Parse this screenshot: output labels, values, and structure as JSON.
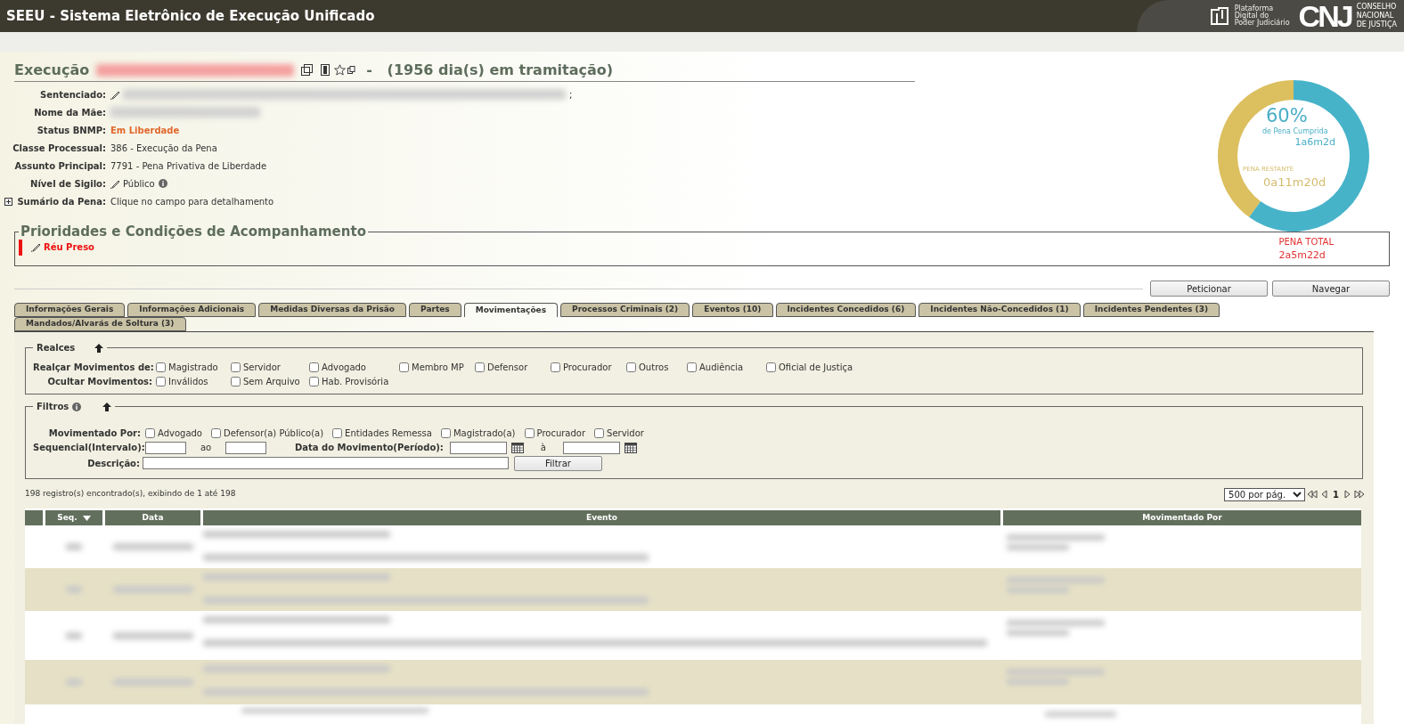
{
  "header": {
    "title": "SEEU - Sistema Eletrônico de Execução Unificado",
    "platform_lines": [
      "Plataforma",
      "Digital do",
      "Poder Judiciário"
    ],
    "cnj_logo": "CNJ",
    "council_lines": [
      "CONSELHO",
      "NACIONAL",
      "DE JUSTIÇA"
    ]
  },
  "process": {
    "title": "Execução",
    "days": "-   (1956 dia(s) em tramitação)"
  },
  "fields": [
    {
      "label": "Sentenciado:",
      "kind": "redacted",
      "pencil": true,
      "suffix": ";"
    },
    {
      "label": "Nome da Mãe:",
      "kind": "redacted",
      "pencil": false
    },
    {
      "label": "Status BNMP:",
      "kind": "status",
      "value": "Em Liberdade",
      "pencil": false
    },
    {
      "label": "Classe Processual:",
      "kind": "text",
      "value": "386 - Execução da Pena",
      "pencil": false
    },
    {
      "label": "Assunto Principal:",
      "kind": "text",
      "value": "7791 - Pena Privativa de Liberdade",
      "pencil": false
    },
    {
      "label": "Nível de Sigilo:",
      "kind": "text",
      "value": "Público",
      "pencil": true,
      "info": true
    },
    {
      "label": "Sumário da Pena:",
      "kind": "text",
      "value": "Clique no campo para detalhamento",
      "pencil": false,
      "expander": true
    }
  ],
  "sentence": {
    "chart_data": {
      "type": "donut",
      "categories": [
        "de Pena Cumprida",
        "PENA RESTANTE"
      ],
      "values": [
        60,
        40
      ]
    },
    "percent": "60%",
    "served": "1a6m2d",
    "remaining": "0a11m20d",
    "total_label": "PENA TOTAL",
    "total": "2a5m22d"
  },
  "priorities": {
    "legend": "Prioridades e Condições de Acompanhamento",
    "items": [
      {
        "label": "Réu Preso",
        "color": "#ee1111"
      }
    ]
  },
  "buttons": [
    "Peticionar",
    "Navegar"
  ],
  "tabs": [
    {
      "label": "Informações Gerais",
      "selected": false
    },
    {
      "label": "Informações Adicionais",
      "selected": false
    },
    {
      "label": "Medidas Diversas da Prisão",
      "selected": false
    },
    {
      "label": "Partes",
      "selected": false
    },
    {
      "label": "Movimentações",
      "selected": true
    },
    {
      "label": "Processos Criminais (2)",
      "selected": false
    },
    {
      "label": "Eventos (10)",
      "selected": false
    },
    {
      "label": "Incidentes Concedidos (6)",
      "selected": false
    },
    {
      "label": "Incidentes Não-Concedidos (1)",
      "selected": false
    },
    {
      "label": "Incidentes Pendentes (3)",
      "selected": false
    },
    {
      "label": "Mandados/Alvarás de Soltura (3)",
      "selected": false
    }
  ],
  "realces": {
    "legend": "Realces",
    "rows": [
      {
        "label": "Realçar Movimentos de:",
        "options": [
          {
            "label": "Magistrado",
            "checked": false
          },
          {
            "label": "Servidor",
            "checked": false
          },
          {
            "label": "Advogado",
            "checked": false
          },
          {
            "label": "Membro MP",
            "checked": false
          },
          {
            "label": "Defensor",
            "checked": false
          },
          {
            "label": "Procurador",
            "checked": false
          },
          {
            "label": "Outros",
            "checked": false
          },
          {
            "label": "Audiência",
            "checked": false
          },
          {
            "label": "Oficial de Justiça",
            "checked": false
          }
        ]
      },
      {
        "label": "Ocultar Movimentos:",
        "options": [
          {
            "label": "Inválidos",
            "checked": false
          },
          {
            "label": "Sem Arquivo",
            "checked": false
          },
          {
            "label": "Hab. Provisória",
            "checked": false
          }
        ]
      }
    ]
  },
  "filtros": {
    "legend": "Filtros",
    "check_label": "Movimentado Por:",
    "options": [
      {
        "label": "Advogado",
        "checked": false
      },
      {
        "label": "Defensor(a) Público(a)",
        "checked": false
      },
      {
        "label": "Entidades Remessa",
        "checked": false
      },
      {
        "label": "Magistrado(a)",
        "checked": false
      },
      {
        "label": "Procurador",
        "checked": false
      },
      {
        "label": "Servidor",
        "checked": false
      }
    ],
    "seq_label": "Sequencial(Intervalo):",
    "seq_between": "ao",
    "date_label": "Data do Movimento(Período):",
    "date_between": "à",
    "desc_label": "Descrição:",
    "button": "Filtrar"
  },
  "results": {
    "summary": "198 registro(s) encontrado(s), exibindo de 1 até 198",
    "page_size": "500 por pág.",
    "page": "1",
    "columns": [
      {
        "label": "Seq.",
        "sorted": true
      },
      {
        "label": "Data",
        "sorted": false
      },
      {
        "label": "Evento",
        "sorted": false
      },
      {
        "label": "Movimentado Por",
        "sorted": false
      }
    ],
    "rows": [
      {
        "kind": "redacted"
      },
      {
        "kind": "redacted"
      },
      {
        "kind": "redacted"
      },
      {
        "kind": "redacted"
      },
      {
        "kind": "redacted_cut"
      }
    ]
  }
}
